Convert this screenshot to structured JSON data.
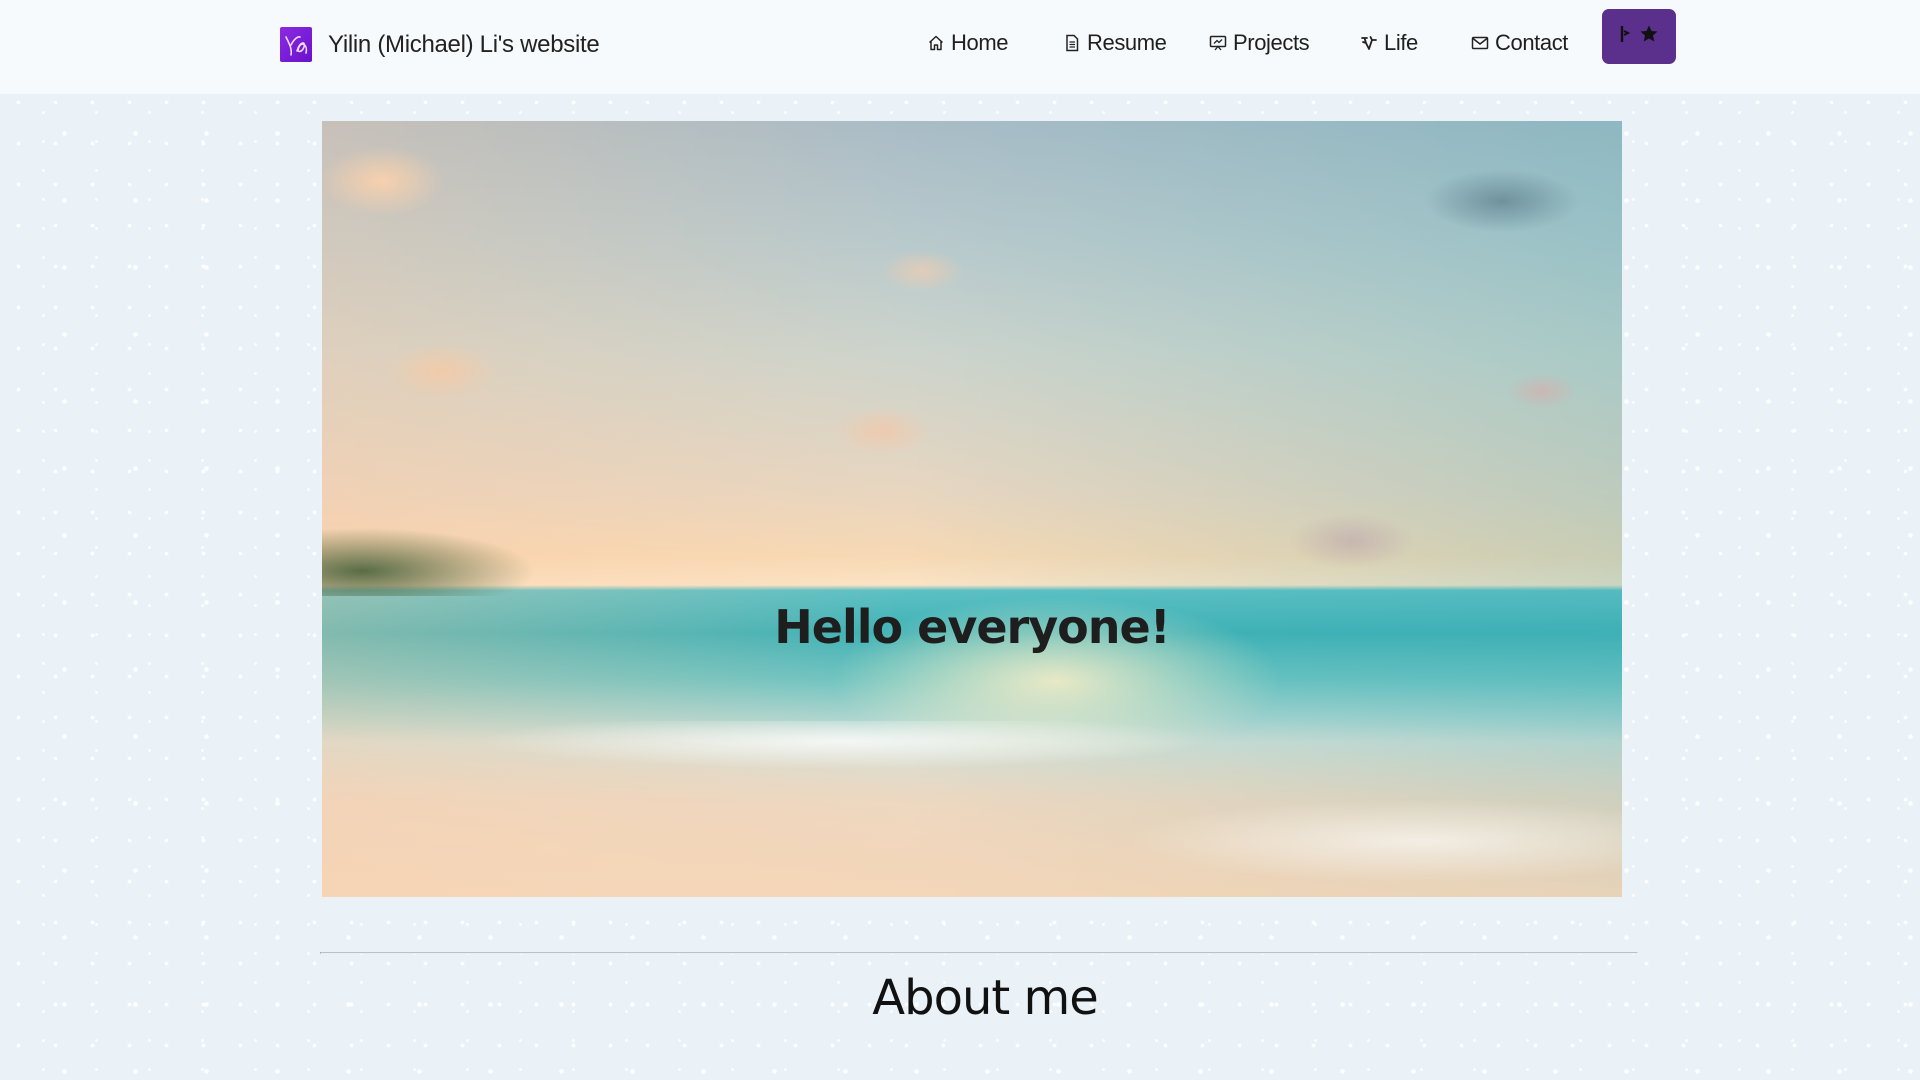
{
  "navbar": {
    "brand": {
      "logo_icon": "ys-monogram-logo",
      "title": "Yilin (Michael) Li's website"
    },
    "items": [
      {
        "label": "Home",
        "icon": "home-icon"
      },
      {
        "label": "Resume",
        "icon": "document-icon"
      },
      {
        "label": "Projects",
        "icon": "presentation-icon"
      },
      {
        "label": "Life",
        "icon": "bicycle-icon"
      },
      {
        "label": "Contact",
        "icon": "envelope-icon"
      }
    ],
    "theme_toggle": {
      "icons": [
        "star-icon"
      ],
      "color": "#5b2f8c"
    }
  },
  "hero": {
    "title": "Hello everyone!"
  },
  "about": {
    "heading": "About me"
  },
  "colors": {
    "page_background": "#eaf2f8",
    "navbar_background": "#f7fafc",
    "accent": "#5b2f8c"
  }
}
